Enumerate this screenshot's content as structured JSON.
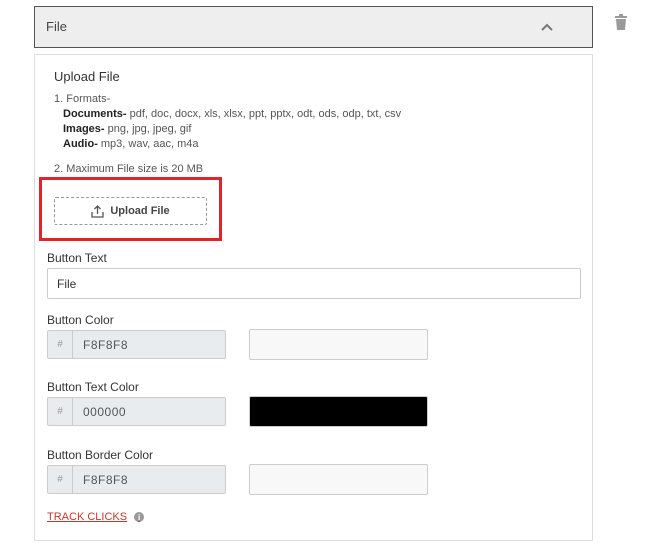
{
  "header": {
    "title": "File",
    "collapse_icon": "chevron-up-icon",
    "delete_icon": "trash-icon"
  },
  "upload": {
    "title": "Upload File",
    "formats_heading": "1. Formats-",
    "documents_label": "Documents-",
    "documents_list": " pdf, doc, docx, xls, xlsx, ppt, pptx, odt, ods, odp, txt, csv",
    "images_label": "Images-",
    "images_list": " png, jpg, jpeg, gif",
    "audio_label": "Audio-",
    "audio_list": " mp3, wav, aac, m4a",
    "max_size": "2. Maximum File size is 20 MB",
    "button_label": "Upload File",
    "highlight_color": "#e0242a"
  },
  "button_text": {
    "label": "Button Text",
    "value": "File"
  },
  "button_color": {
    "label": "Button Color",
    "prefix": "#",
    "value": "F8F8F8",
    "swatch": "#F8F8F8"
  },
  "button_text_color": {
    "label": "Button Text Color",
    "prefix": "#",
    "value": "000000",
    "swatch": "#000000"
  },
  "button_border_color": {
    "label": "Button Border Color",
    "prefix": "#",
    "value": "F8F8F8",
    "swatch": "#F8F8F8"
  },
  "track_clicks": {
    "label": "TRACK CLICKS",
    "info": "i",
    "color": "#c0392b"
  }
}
